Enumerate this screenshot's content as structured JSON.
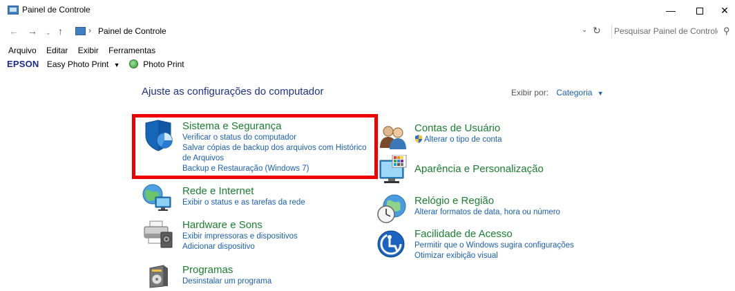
{
  "window": {
    "title": "Painel de Controle",
    "minimize": "—",
    "close": "✕"
  },
  "nav": {
    "back": "←",
    "forward": "→",
    "history": "⌄",
    "up": "↑",
    "separator": "›",
    "address": "Painel de Controle",
    "dropdown": "⌄",
    "refresh": "↻",
    "search_placeholder": "Pesquisar Painel de Controle",
    "search_icon": "⚲"
  },
  "menu": [
    "Arquivo",
    "Editar",
    "Exibir",
    "Ferramentas"
  ],
  "epson": {
    "logo": "EPSON",
    "easy_photo_print": "Easy Photo Print",
    "caret": "▼",
    "photo_print": "Photo Print"
  },
  "main": {
    "heading": "Ajuste as configurações do computador",
    "view_by_label": "Exibir por:",
    "view_by_value": "Categoria",
    "view_by_caret": "▼"
  },
  "categories_left": [
    {
      "title": "Sistema e Segurança",
      "icon": "shield-icon",
      "links": [
        "Verificar o status do computador",
        "Salvar cópias de backup dos arquivos com Histórico",
        "de Arquivos",
        "Backup e Restauração (Windows 7)"
      ]
    },
    {
      "title": "Rede e Internet",
      "icon": "network-icon",
      "links": [
        "Exibir o status e as tarefas da rede"
      ]
    },
    {
      "title": "Hardware e Sons",
      "icon": "printer-icon",
      "links": [
        "Exibir impressoras e dispositivos",
        "Adicionar dispositivo"
      ]
    },
    {
      "title": "Programas",
      "icon": "programs-icon",
      "links": [
        "Desinstalar um programa"
      ]
    }
  ],
  "categories_right": [
    {
      "title": "Contas de Usuário",
      "icon": "users-icon",
      "links": [
        "Alterar o tipo de conta"
      ]
    },
    {
      "title": "Aparência e Personalização",
      "icon": "appearance-icon",
      "links": []
    },
    {
      "title": "Relógio e Região",
      "icon": "clock-icon",
      "links": [
        "Alterar formatos de data, hora ou número"
      ]
    },
    {
      "title": "Facilidade de Acesso",
      "icon": "accessibility-icon",
      "links": [
        "Permitir que o Windows sugira configurações",
        "Otimizar exibição visual"
      ]
    }
  ],
  "colors": {
    "category_title": "#1a8030",
    "link": "#1a5fb4",
    "heading": "#1e3287",
    "highlight": "#f00000"
  }
}
